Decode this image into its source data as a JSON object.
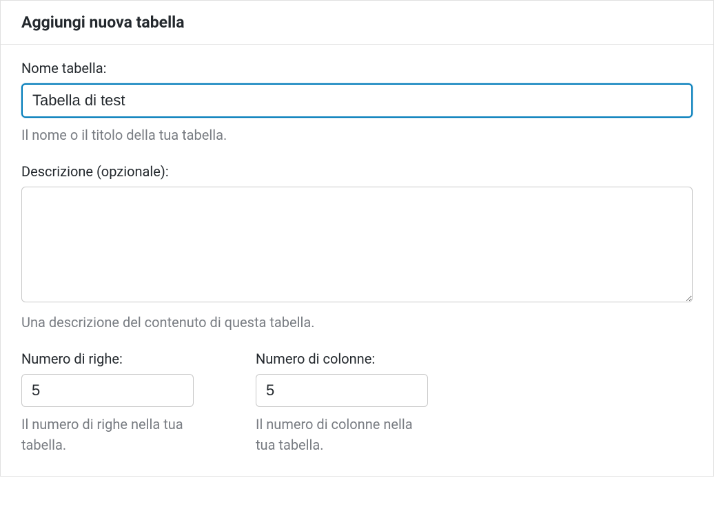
{
  "panel": {
    "title": "Aggiungi nuova tabella"
  },
  "fields": {
    "name": {
      "label": "Nome tabella:",
      "value": "Tabella di test",
      "help": "Il nome o il titolo della tua tabella."
    },
    "description": {
      "label": "Descrizione (opzionale):",
      "value": "",
      "help": "Una descrizione del contenuto di questa tabella."
    },
    "rows": {
      "label": "Numero di righe:",
      "value": "5",
      "help": "Il numero di righe nella tua tabella."
    },
    "cols": {
      "label": "Numero di colonne:",
      "value": "5",
      "help": "Il numero di colonne nella tua tabella."
    }
  }
}
